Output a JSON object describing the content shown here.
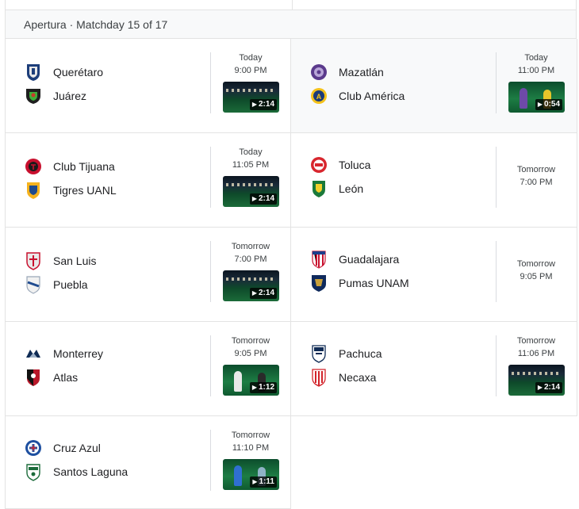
{
  "header": {
    "title": "Apertura · Matchday 15 of 17"
  },
  "matches": [
    {
      "home": {
        "name": "Querétaro",
        "crest": "queretaro-crest"
      },
      "away": {
        "name": "Juárez",
        "crest": "juarez-crest"
      },
      "day": "Today",
      "time": "9:00 PM",
      "duration": "2:14"
    },
    {
      "home": {
        "name": "Mazatlán",
        "crest": "mazatlan-crest"
      },
      "away": {
        "name": "Club América",
        "crest": "america-crest"
      },
      "day": "Today",
      "time": "11:00 PM",
      "duration": "0:54"
    },
    {
      "home": {
        "name": "Club Tijuana",
        "crest": "tijuana-crest"
      },
      "away": {
        "name": "Tigres UANL",
        "crest": "tigres-crest"
      },
      "day": "Today",
      "time": "11:05 PM",
      "duration": "2:14"
    },
    {
      "home": {
        "name": "Toluca",
        "crest": "toluca-crest"
      },
      "away": {
        "name": "León",
        "crest": "leon-crest"
      },
      "day": "Tomorrow",
      "time": "7:00 PM",
      "duration": null
    },
    {
      "home": {
        "name": "San Luis",
        "crest": "sanluis-crest"
      },
      "away": {
        "name": "Puebla",
        "crest": "puebla-crest"
      },
      "day": "Tomorrow",
      "time": "7:00 PM",
      "duration": "2:14"
    },
    {
      "home": {
        "name": "Guadalajara",
        "crest": "guadalajara-crest"
      },
      "away": {
        "name": "Pumas UNAM",
        "crest": "pumas-crest"
      },
      "day": "Tomorrow",
      "time": "9:05 PM",
      "duration": null
    },
    {
      "home": {
        "name": "Monterrey",
        "crest": "monterrey-crest"
      },
      "away": {
        "name": "Atlas",
        "crest": "atlas-crest"
      },
      "day": "Tomorrow",
      "time": "9:05 PM",
      "duration": "1:12"
    },
    {
      "home": {
        "name": "Pachuca",
        "crest": "pachuca-crest"
      },
      "away": {
        "name": "Necaxa",
        "crest": "necaxa-crest"
      },
      "day": "Tomorrow",
      "time": "11:06 PM",
      "duration": "2:14"
    },
    {
      "home": {
        "name": "Cruz Azul",
        "crest": "cruzazul-crest"
      },
      "away": {
        "name": "Santos Laguna",
        "crest": "santos-crest"
      },
      "day": "Tomorrow",
      "time": "11:10 PM",
      "duration": "1:11"
    }
  ]
}
